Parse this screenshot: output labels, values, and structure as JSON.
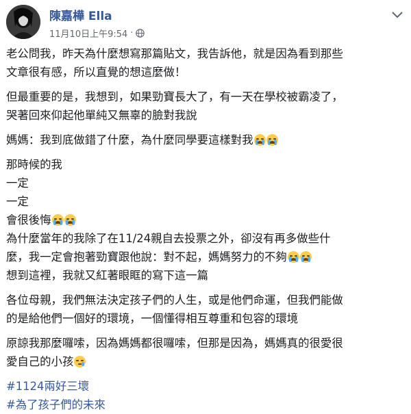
{
  "post": {
    "author": "陳嘉樺 Ella",
    "timestamp": "11月10日上午9:54",
    "separator": "·",
    "privacy_icon": "globe-icon",
    "menu_icon": "chevron-down-icon"
  },
  "lines": {
    "l1": "老公問我，昨天為什麼想寫那篇貼文，我告訴他，就是因為看到那些",
    "l2": "文章很有感，所以直覺的想這麼做！",
    "l3": "但最重要的是，我想到，如果勁寶長大了，有一天在學校被霸凌了，",
    "l4": "哭著回來仰起他單純又無辜的臉對我說",
    "l5": "媽媽：我到底做錯了什麼，為什麼同學要這樣對我",
    "l6": "那時候的我",
    "l7": "一定",
    "l8": "一定",
    "l9": "會很後悔",
    "l10": "為什麼當年的我除了在11/24親自去投票之外，卻沒有再多做些什",
    "l11": "麼，我一定會抱著勁寶跟他說：對不起，媽媽努力的不夠",
    "l12": "想到這裡，我就又紅著眼眶的寫下這一篇",
    "l13": "各位母親，我們無法決定孩子們的人生，或是他們命運，但我們能做",
    "l14": "的是給他們一個好的環境，一個懂得相互尊重和包容的環境",
    "l15": "原諒我那麼囉嗦，因為媽媽都很囉嗦，但那是因為，媽媽真的很愛很",
    "l16": "愛自己的小孩"
  },
  "hashtags": {
    "h1": "#1124兩好三壞",
    "h2": "#為了孩子們的未來"
  },
  "emoji": {
    "crying": "loudly-crying-face",
    "sad": "sad-face"
  },
  "colors": {
    "author": "#365899",
    "meta": "#606770",
    "text": "#1c1e21",
    "hashtag": "#365899"
  }
}
